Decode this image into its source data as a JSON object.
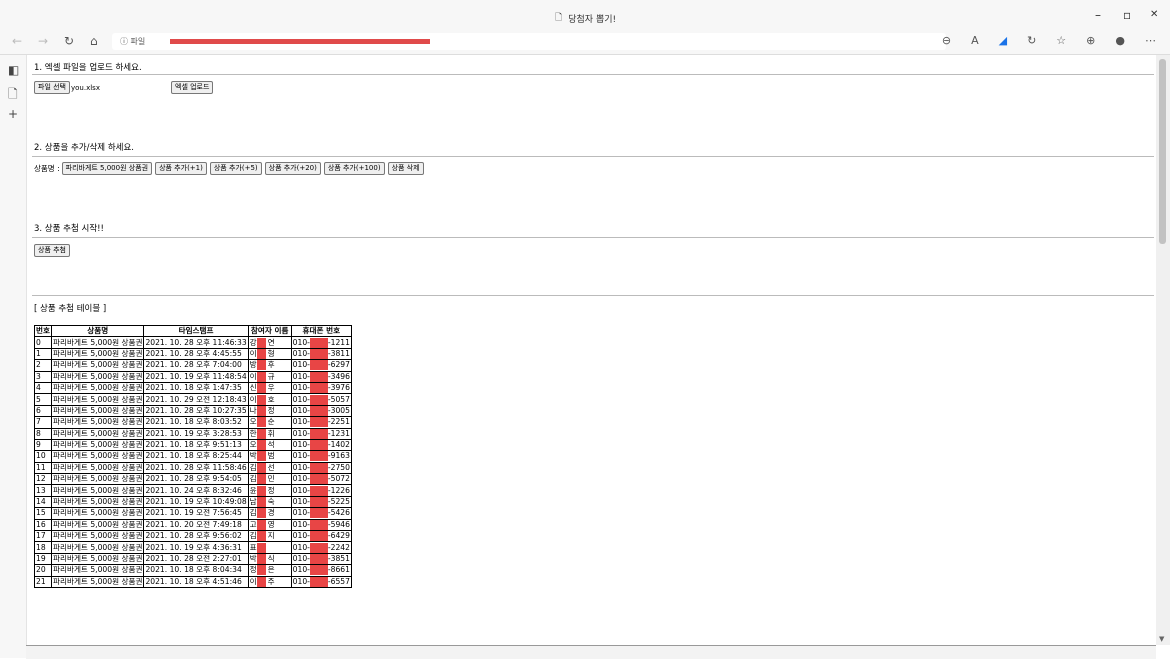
{
  "window": {
    "title": "당첨자 뽑기!",
    "minimize": "–",
    "restore": "▫",
    "close": "✕"
  },
  "toolbar": {
    "address_prefix": "ⓘ 파일",
    "icons": [
      "zoom-icon",
      "read-aloud-icon",
      "extension-icon",
      "refresh-icon",
      "favorite-icon",
      "collections-icon",
      "profile-icon",
      "more-icon"
    ]
  },
  "section1": {
    "heading": "1. 엑셀 파일을 업로드 하세요.",
    "file_button": "파일 선택",
    "file_name": "you.xlsx",
    "upload_button": "엑셀 업로드"
  },
  "section2": {
    "heading": "2. 상품을 추가/삭제 하세요.",
    "label": "상품명 :",
    "product_input": "파리바게트 5,000원 상품권",
    "buttons": [
      "상품 추가(+1)",
      "상품 추가(+5)",
      "상품 추가(+20)",
      "상품 추가(+100)",
      "상품 삭제"
    ]
  },
  "section3": {
    "heading": "3. 상품 추첨 시작!!",
    "draw_button": "상품 추첨"
  },
  "table": {
    "caption": "[ 상품 추첨 테이블 ]",
    "headers": [
      "번호",
      "상품명",
      "타임스탬프",
      "참여자 이름",
      "휴대폰 번호"
    ],
    "rows": [
      {
        "no": "0",
        "product": "파리바게트 5,000원 상품권",
        "ts": "2021. 10. 28 오후 11:46:33",
        "n1": "강",
        "n2": "연",
        "p1": "010-",
        "p2": "-1211"
      },
      {
        "no": "1",
        "product": "파리바게트 5,000원 상품권",
        "ts": "2021. 10. 28 오후 4:45:55",
        "n1": "이",
        "n2": "형",
        "p1": "010-",
        "p2": "-3811"
      },
      {
        "no": "2",
        "product": "파리바게트 5,000원 상품권",
        "ts": "2021. 10. 28 오후 7:04:00",
        "n1": "방",
        "n2": "후",
        "p1": "010-",
        "p2": "-6297"
      },
      {
        "no": "3",
        "product": "파리바게트 5,000원 상품권",
        "ts": "2021. 10. 19 오후 11:48:54",
        "n1": "이",
        "n2": "규",
        "p1": "010-",
        "p2": "-3496"
      },
      {
        "no": "4",
        "product": "파리바게트 5,000원 상품권",
        "ts": "2021. 10. 18 오후 1:47:35",
        "n1": "신",
        "n2": "우",
        "p1": "010-",
        "p2": "-3976"
      },
      {
        "no": "5",
        "product": "파리바게트 5,000원 상품권",
        "ts": "2021. 10. 29 오전 12:18:43",
        "n1": "이",
        "n2": "호",
        "p1": "010-",
        "p2": "-5057"
      },
      {
        "no": "6",
        "product": "파리바게트 5,000원 상품권",
        "ts": "2021. 10. 28 오후 10:27:35",
        "n1": "나",
        "n2": "정",
        "p1": "010-",
        "p2": "-3005"
      },
      {
        "no": "7",
        "product": "파리바게트 5,000원 상품권",
        "ts": "2021. 10. 18 오후 8:03:52",
        "n1": "오",
        "n2": "순",
        "p1": "010-",
        "p2": "-2251"
      },
      {
        "no": "8",
        "product": "파리바게트 5,000원 상품권",
        "ts": "2021. 10. 19 오후 3:28:53",
        "n1": "한",
        "n2": "휘",
        "p1": "010-",
        "p2": "-1231"
      },
      {
        "no": "9",
        "product": "파리바게트 5,000원 상품권",
        "ts": "2021. 10. 18 오후 9:51:13",
        "n1": "오",
        "n2": "석",
        "p1": "010-",
        "p2": "-1402"
      },
      {
        "no": "10",
        "product": "파리바게트 5,000원 상품권",
        "ts": "2021. 10. 18 오후 8:25:44",
        "n1": "박",
        "n2": "범",
        "p1": "010-",
        "p2": "-9163"
      },
      {
        "no": "11",
        "product": "파리바게트 5,000원 상품권",
        "ts": "2021. 10. 28 오후 11:58:46",
        "n1": "김",
        "n2": "선",
        "p1": "010-",
        "p2": "-2750"
      },
      {
        "no": "12",
        "product": "파리바게트 5,000원 상품권",
        "ts": "2021. 10. 28 오후 9:54:05",
        "n1": "김",
        "n2": "민",
        "p1": "010-",
        "p2": "-5072"
      },
      {
        "no": "13",
        "product": "파리바게트 5,000원 상품권",
        "ts": "2021. 10. 24 오후 8:32:46",
        "n1": "윤",
        "n2": "정",
        "p1": "010-",
        "p2": "-1226"
      },
      {
        "no": "14",
        "product": "파리바게트 5,000원 상품권",
        "ts": "2021. 10. 19 오후 10:49:08",
        "n1": "남",
        "n2": "숙",
        "p1": "010-",
        "p2": "-5225"
      },
      {
        "no": "15",
        "product": "파리바게트 5,000원 상품권",
        "ts": "2021. 10. 19 오전 7:56:45",
        "n1": "김",
        "n2": "경",
        "p1": "010-",
        "p2": "-5426"
      },
      {
        "no": "16",
        "product": "파리바게트 5,000원 상품권",
        "ts": "2021. 10. 20 오전 7:49:18",
        "n1": "고",
        "n2": "영",
        "p1": "010-",
        "p2": "-5946"
      },
      {
        "no": "17",
        "product": "파리바게트 5,000원 상품권",
        "ts": "2021. 10. 28 오후 9:56:02",
        "n1": "김",
        "n2": "지",
        "p1": "010-",
        "p2": "-6429"
      },
      {
        "no": "18",
        "product": "파리바게트 5,000원 상품권",
        "ts": "2021. 10. 19 오후 4:36:31",
        "n1": "표",
        "n2": "",
        "p1": "010-",
        "p2": "-2242"
      },
      {
        "no": "19",
        "product": "파리바게트 5,000원 상품권",
        "ts": "2021. 10. 28 오전 2:27:01",
        "n1": "박",
        "n2": "식",
        "p1": "010-",
        "p2": "-3851"
      },
      {
        "no": "20",
        "product": "파리바게트 5,000원 상품권",
        "ts": "2021. 10. 18 오후 8:04:34",
        "n1": "정",
        "n2": "은",
        "p1": "010-",
        "p2": "-8661"
      },
      {
        "no": "21",
        "product": "파리바게트 5,000원 상품권",
        "ts": "2021. 10. 18 오후 4:51:46",
        "n1": "이",
        "n2": "주",
        "p1": "010-",
        "p2": "-6557"
      }
    ]
  },
  "colors": {
    "redaction": "#e84545",
    "chrome_bg": "#f7f7f7"
  }
}
